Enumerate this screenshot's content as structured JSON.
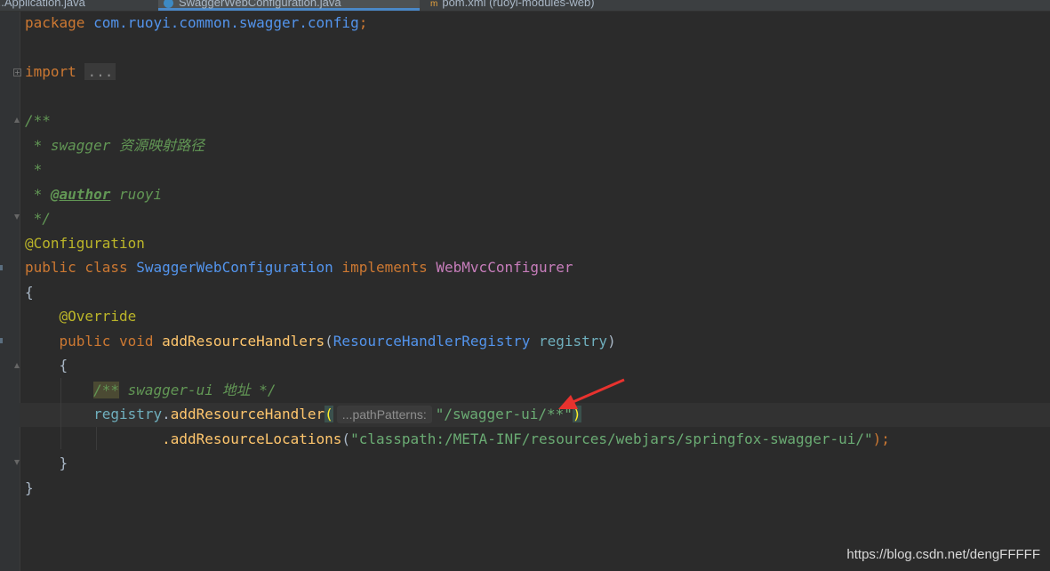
{
  "tabs": [
    {
      "label": "...Application.java",
      "active": false
    },
    {
      "label": "SwaggerWebConfiguration.java",
      "active": true
    },
    {
      "label": "pom.xml (ruoyi-modules-web)",
      "active": false
    }
  ],
  "code": {
    "package_kw": "package",
    "package_name": "com.ruoyi.common.swagger.config",
    "semicolon": ";",
    "import_kw": "import",
    "import_folded": "...",
    "doc_open": "/**",
    "doc_line1": " * swagger 资源映射路径",
    "doc_line2": " *",
    "doc_author_prefix": " * ",
    "doc_author_tag": "@author",
    "doc_author_name": " ruoyi",
    "doc_close": " */",
    "annotation_config": "@Configuration",
    "public_class": "public class ",
    "class_name": "SwaggerWebConfiguration",
    "implements_kw": " implements ",
    "interface_name": "WebMvcConfigurer",
    "brace_open": "{",
    "annotation_override": "@Override",
    "public_void": "public void ",
    "method_name": "addResourceHandlers",
    "paren_open": "(",
    "param_type": "ResourceHandlerRegistry",
    "param_name": " registry",
    "paren_close": ")",
    "inner_brace_open": "{",
    "inline_comment_open": "/**",
    "inline_comment_body": " swagger-ui 地址 */",
    "registry_var": "registry",
    "dot": ".",
    "add_handler": "addResourceHandler",
    "param_hint": "...pathPatterns:",
    "path_pattern": "\"/swagger-ui/**\"",
    "add_locations": ".addResourceLocations",
    "locations_value": "\"classpath:/META-INF/resources/webjars/springfox-swagger-ui/\"",
    "close_stmt": ");",
    "inner_brace_close": "}",
    "brace_close": "}"
  },
  "watermark": "https://blog.csdn.net/dengFFFFF",
  "colors": {
    "background": "#2b2b2b",
    "arrow": "#e8322e",
    "keyword": "#cc7832",
    "string": "#6a8759",
    "comment": "#629755"
  }
}
